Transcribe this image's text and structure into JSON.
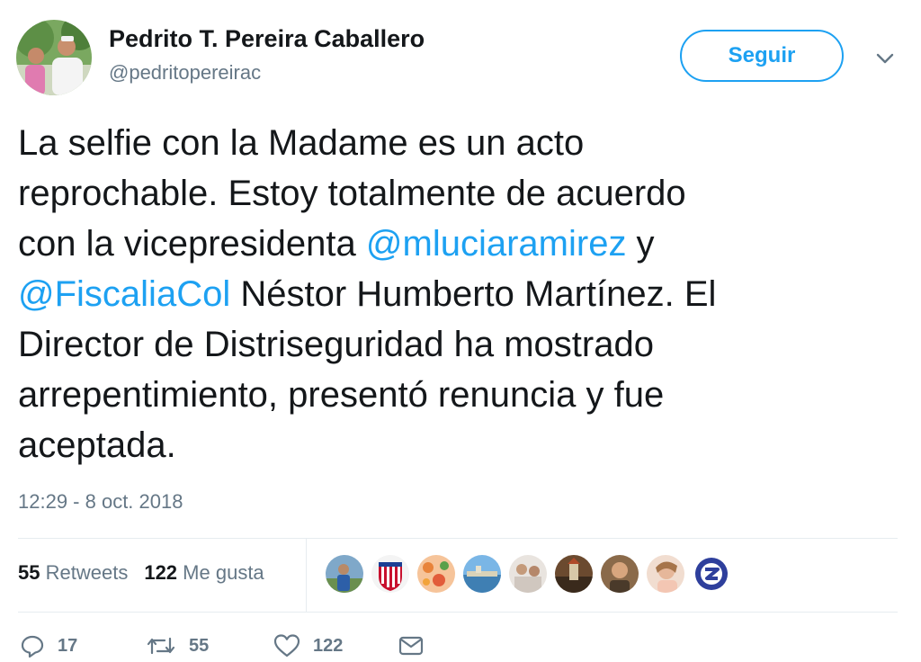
{
  "author": {
    "name": "Pedrito T. Pereira Caballero",
    "handle": "@pedritopereirac",
    "avatar_icon": "profile-photo"
  },
  "follow_button": {
    "label": "Seguir"
  },
  "caret_icon": "chevron-down-icon",
  "tweet": {
    "lines": [
      [
        {
          "t": "La selfie con la Madame es un acto",
          "m": false
        }
      ],
      [
        {
          "t": "reprochable. Estoy totalmente de acuerdo",
          "m": false
        }
      ],
      [
        {
          "t": "con la vicepresidenta ",
          "m": false
        },
        {
          "t": "@mluciaramirez",
          "m": true
        },
        {
          "t": "  y",
          "m": false
        }
      ],
      [
        {
          "t": "@FiscaliaCol",
          "m": true
        },
        {
          "t": " Néstor Humberto Martínez. El",
          "m": false
        }
      ],
      [
        {
          "t": "Director de Distriseguridad ha mostrado",
          "m": false
        }
      ],
      [
        {
          "t": "arrepentimiento, presentó renuncia y fue",
          "m": false
        }
      ],
      [
        {
          "t": "aceptada.",
          "m": false
        }
      ]
    ],
    "timestamp": "12:29 - 8 oct. 2018"
  },
  "stats": {
    "retweets_count": "55",
    "retweets_label": "Retweets",
    "likes_count": "122",
    "likes_label": "Me gusta"
  },
  "likers": [
    "liker-avatar-1",
    "liker-avatar-2",
    "liker-avatar-3",
    "liker-avatar-4",
    "liker-avatar-5",
    "liker-avatar-6",
    "liker-avatar-7",
    "liker-avatar-8",
    "liker-avatar-9"
  ],
  "actions": {
    "reply_count": "17",
    "retweet_count": "55",
    "like_count": "122"
  },
  "colors": {
    "accent": "#1da1f2",
    "muted": "#657786",
    "text": "#14171a",
    "divider": "#e6ecf0"
  }
}
